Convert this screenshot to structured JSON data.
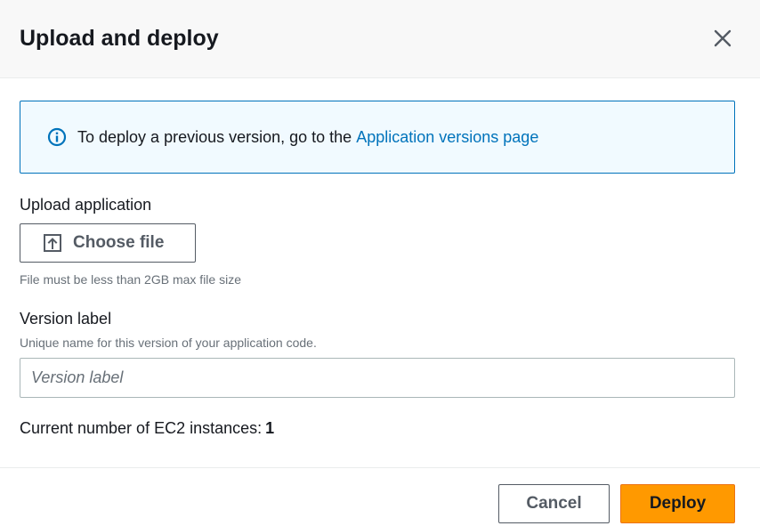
{
  "modal": {
    "title": "Upload and deploy",
    "close_icon": "close-icon"
  },
  "info": {
    "icon": "info-circle-icon",
    "text": "To deploy a previous version, go to the",
    "link_text": "Application versions page"
  },
  "upload": {
    "label": "Upload application",
    "button_label": "Choose file",
    "button_icon": "upload-icon",
    "hint": "File must be less than 2GB max file size"
  },
  "version": {
    "label": "Version label",
    "description": "Unique name for this version of your application code.",
    "placeholder": "Version label",
    "value": ""
  },
  "instances": {
    "label": "Current number of EC2 instances:",
    "count": "1"
  },
  "footer": {
    "cancel_label": "Cancel",
    "deploy_label": "Deploy"
  },
  "colors": {
    "link": "#0073bb",
    "info_bg": "#f1faff",
    "primary": "#ff9900",
    "text": "#16191f",
    "muted": "#687078"
  }
}
